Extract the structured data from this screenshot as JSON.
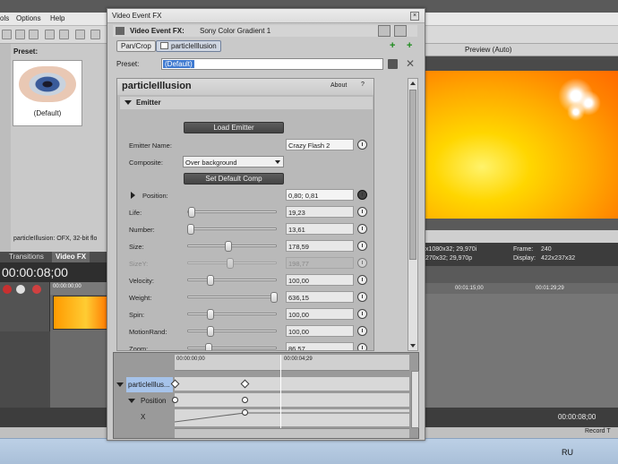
{
  "background_app": {
    "menu": [
      "ols",
      "Options",
      "Help"
    ],
    "preset_panel": {
      "title": "Preset:",
      "preset_caption": "(Default)",
      "status": "particleIllusion: OFX, 32-bit flo"
    },
    "tabs": {
      "transitions": "Transitions",
      "video_fx": "Video FX"
    },
    "timecode": "00:00:08;00",
    "ruler_left": "00:00:00;00",
    "preview": {
      "mode": "Preview (Auto)",
      "project_line1": "x1080x32; 29,970i",
      "project_line2": "270x32; 29,970p",
      "frame_label": "Frame:",
      "frame_value": "240",
      "display_label": "Display:",
      "display_value": "422x237x32"
    },
    "ruler_right": [
      "00:01:15;00",
      "00:01:29;29"
    ],
    "bottom_timecode": "00:00:08;00",
    "record_label": "Record T",
    "taskbar_lang": "RU"
  },
  "dialog": {
    "title": "Video Event FX",
    "fx_label": "Video Event FX:",
    "plugin_name": "Sony Color Gradient 1",
    "chain": [
      {
        "label": "Pan/Crop",
        "active": false
      },
      {
        "label": "particleIllusion",
        "active": true
      }
    ],
    "preset_label": "Preset:",
    "preset_value": "(Default)",
    "plugin_panel": {
      "title": "particleIllusion",
      "about": "About",
      "help": "?",
      "section": "Emitter",
      "load_emitter": "Load Emitter",
      "emitter_name_label": "Emitter Name:",
      "emitter_name_value": "Crazy Flash 2",
      "composite_label": "Composite:",
      "composite_value": "Over background",
      "set_default_comp": "Set Default Comp",
      "position_label": "Position:",
      "position_value": "0,80; 0,81",
      "params": [
        {
          "label": "Life:",
          "value": "19,23",
          "fraction": 0.04,
          "dim": false
        },
        {
          "label": "Number:",
          "value": "13,61",
          "fraction": 0.03,
          "dim": false
        },
        {
          "label": "Size:",
          "value": "178,59",
          "fraction": 0.46,
          "dim": false
        },
        {
          "label": "SizeY:",
          "value": "198,77",
          "fraction": 0.48,
          "dim": true
        },
        {
          "label": "Velocity:",
          "value": "100,00",
          "fraction": 0.26,
          "dim": false
        },
        {
          "label": "Weight:",
          "value": "636,15",
          "fraction": 0.98,
          "dim": false
        },
        {
          "label": "Spin:",
          "value": "100,00",
          "fraction": 0.26,
          "dim": false
        },
        {
          "label": "MotionRand:",
          "value": "100,00",
          "fraction": 0.26,
          "dim": false
        },
        {
          "label": "Zoom:",
          "value": "86,57",
          "fraction": 0.23,
          "dim": false
        }
      ]
    },
    "keyframes": {
      "ruler": [
        "00:00:00;00",
        "00:00:04;29"
      ],
      "tracks": [
        "particleIllus...",
        "Position",
        "X"
      ]
    }
  }
}
